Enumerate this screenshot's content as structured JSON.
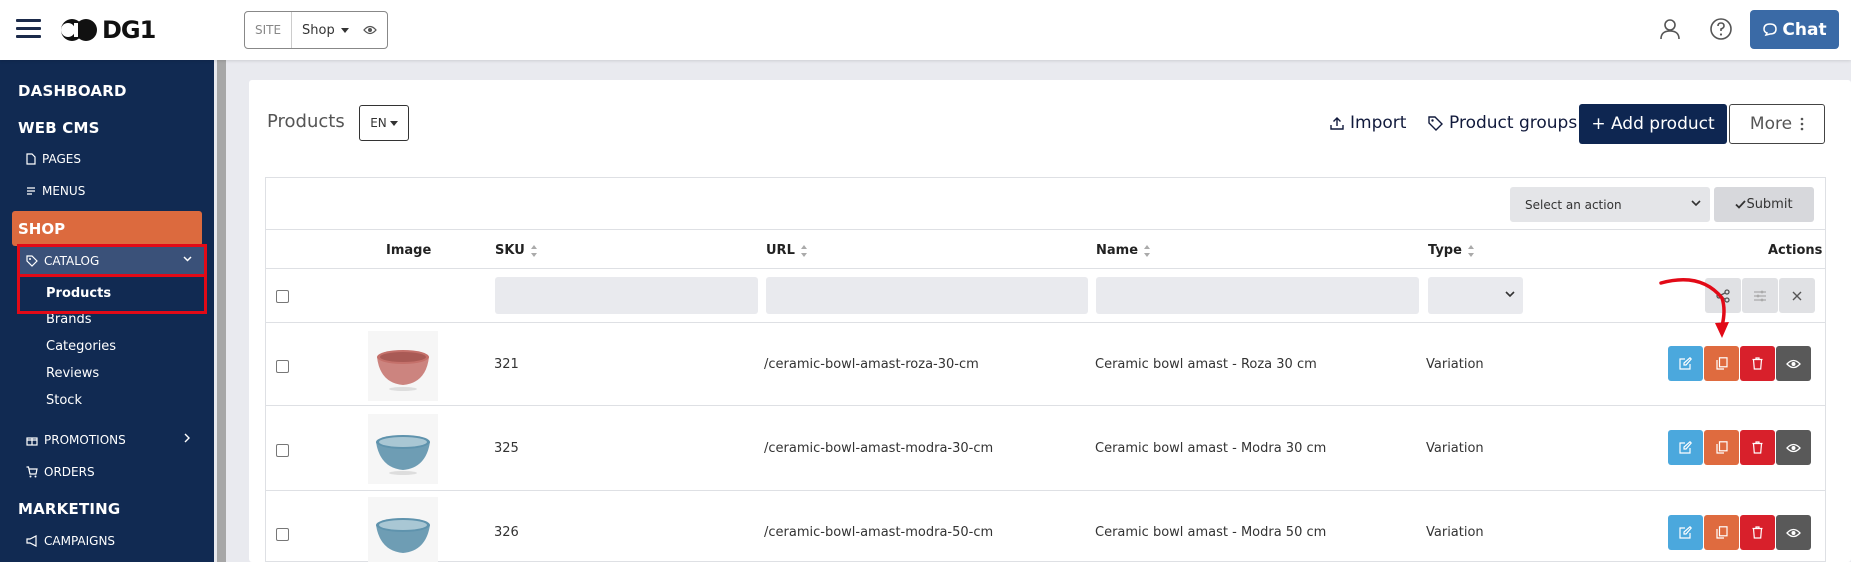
{
  "topbar": {
    "logo_text": "DG1",
    "site_label": "SITE",
    "site_value": "Shop",
    "chat_label": "Chat",
    "chat_color": "#3a6aa6"
  },
  "sidebar": {
    "dashboard": "DASHBOARD",
    "web_cms": "WEB CMS",
    "pages": "PAGES",
    "menus": "MENUS",
    "shop": "SHOP",
    "catalog": "CATALOG",
    "catalog_sub": [
      "Products",
      "Brands",
      "Categories",
      "Reviews",
      "Stock"
    ],
    "promotions": "PROMOTIONS",
    "orders": "ORDERS",
    "marketing": "MARKETING",
    "campaigns": "CAMPAIGNS",
    "bg_color": "#112a52",
    "shop_color": "#dc6a3e"
  },
  "header": {
    "title": "Products",
    "lang": "EN",
    "import_label": "Import",
    "groups_label": "Product groups",
    "add_label": "+ Add product",
    "more_label": "More"
  },
  "bulk": {
    "action_placeholder": "Select an action",
    "submit_label": "Submit"
  },
  "table": {
    "columns": {
      "image": "Image",
      "sku": "SKU",
      "url": "URL",
      "name": "Name",
      "type": "Type",
      "actions": "Actions"
    },
    "rows": [
      {
        "sku": "321",
        "url": "/ceramic-bowl-amast-roza-30-cm",
        "name": "Ceramic bowl amast - Roza 30 cm",
        "type": "Variation",
        "bowl_color": "#c4706a"
      },
      {
        "sku": "325",
        "url": "/ceramic-bowl-amast-modra-30-cm",
        "name": "Ceramic bowl amast - Modra 30 cm",
        "type": "Variation",
        "bowl_color": "#5f93ad"
      },
      {
        "sku": "326",
        "url": "/ceramic-bowl-amast-modra-50-cm",
        "name": "Ceramic bowl amast - Modra 50 cm",
        "type": "Variation",
        "bowl_color": "#5f93ad"
      }
    ]
  }
}
